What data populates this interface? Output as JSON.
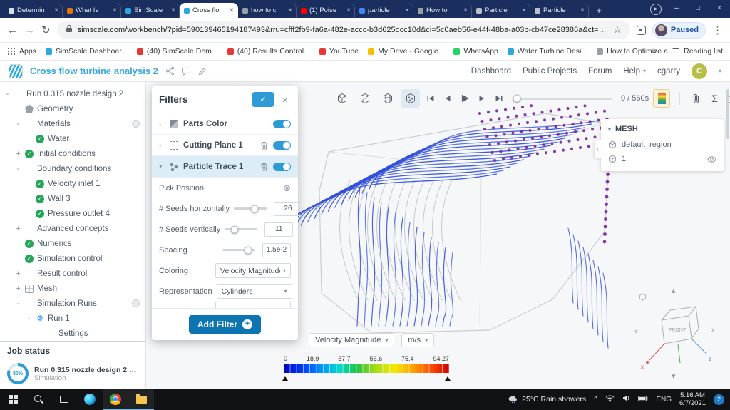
{
  "icons": {
    "back": "←",
    "forward": "→",
    "refresh": "↻",
    "star": "☆",
    "menu": "⋮",
    "close": "×",
    "check": "✓",
    "plus": "+",
    "play": "▶",
    "caret_down": "▾",
    "caret_up": "▴",
    "chev_left": "‹",
    "chev_right": "›",
    "overflow": "»",
    "sigma": "Σ",
    "gear": "⚙",
    "target": "⊗",
    "tray_up": "^"
  },
  "browser": {
    "window": {
      "minimize": "–",
      "maximize": "□",
      "close": "×"
    },
    "tabs": [
      {
        "label": "Determin",
        "color": "#d8dee6"
      },
      {
        "label": "What Is",
        "color": "#e8710a"
      },
      {
        "label": "SimScale",
        "color": "#29a8df"
      },
      {
        "label": "Cross flo",
        "color": "#29a8df",
        "active": true
      },
      {
        "label": "how to c",
        "color": "#9aa0a6"
      },
      {
        "label": "(1) Poise",
        "color": "#ff0000"
      },
      {
        "label": "particle",
        "color": "#4285f4"
      },
      {
        "label": "How to",
        "color": "#9aa0a6"
      },
      {
        "label": "Particle",
        "color": "#bdc1c6"
      },
      {
        "label": "Particle",
        "color": "#bdc1c6"
      }
    ],
    "url": "simscale.com/workbench/?pid=590139465194187493&rru=cfff2fb9-fa6a-482e-accc-b3d625dcc10d&ci=5c0aeb56-e44f-48ba-a03b-cb47ce28386a&ct=SOLUTION_...",
    "paused_label": "Paused",
    "apps_label": "Apps",
    "bookmarks": [
      {
        "label": "SimScale Dashboar...",
        "color": "#2da9dd"
      },
      {
        "label": "(40) SimScale Dem...",
        "color": "#e53935"
      },
      {
        "label": "(40) Results Control...",
        "color": "#e53935"
      },
      {
        "label": "YouTube",
        "color": "#e53935"
      },
      {
        "label": "My Drive - Google...",
        "color": "#fbbc04"
      },
      {
        "label": "WhatsApp",
        "color": "#25d366"
      },
      {
        "label": "Water Turbine Desi...",
        "color": "#2da9dd"
      },
      {
        "label": "How to Optimize a...",
        "color": "#9aa0a6"
      }
    ],
    "reading_list_label": "Reading list"
  },
  "app_header": {
    "project_title": "Cross flow turbine analysis 2",
    "nav": [
      "Dashboard",
      "Public Projects",
      "Forum",
      "Help"
    ],
    "user": "cgarry",
    "avatar": "C"
  },
  "tree": {
    "items": [
      {
        "label": "Run 0.315 nozzle design 2",
        "level": 0,
        "exp": "-",
        "status": "none"
      },
      {
        "label": "Geometry",
        "level": 1,
        "exp": "",
        "status": "geometry"
      },
      {
        "label": "Materials",
        "level": 1,
        "exp": "-",
        "status": "none",
        "menu": true
      },
      {
        "label": "Water",
        "level": 2,
        "exp": "",
        "status": "check"
      },
      {
        "label": "Initial conditions",
        "level": 1,
        "exp": "+",
        "status": "check"
      },
      {
        "label": "Boundary conditions",
        "level": 1,
        "exp": "-",
        "status": "none"
      },
      {
        "label": "Velocity inlet 1",
        "level": 2,
        "exp": "",
        "status": "check"
      },
      {
        "label": "Wall 3",
        "level": 2,
        "exp": "",
        "status": "check"
      },
      {
        "label": "Pressure outlet 4",
        "level": 2,
        "exp": "",
        "status": "check"
      },
      {
        "label": "Advanced concepts",
        "level": 1,
        "exp": "+",
        "status": "none"
      },
      {
        "label": "Numerics",
        "level": 1,
        "exp": "",
        "status": "check"
      },
      {
        "label": "Simulation control",
        "level": 1,
        "exp": "",
        "status": "check"
      },
      {
        "label": "Result control",
        "level": 1,
        "exp": "+",
        "status": "none"
      },
      {
        "label": "Mesh",
        "level": 1,
        "exp": "+",
        "status": "mesh"
      },
      {
        "label": "Simulation Runs",
        "level": 1,
        "exp": "-",
        "status": "none",
        "menu": true
      },
      {
        "label": "Run 1",
        "level": 2,
        "exp": "-",
        "status": "gear"
      },
      {
        "label": "Settings",
        "level": 3,
        "exp": "",
        "status": "none"
      }
    ]
  },
  "job_status": {
    "title": "Job status",
    "progress_label": "80%",
    "run_label": "Run 0.315 nozzle design 2 - ...",
    "run_sub": "Simulation"
  },
  "filters": {
    "title": "Filters",
    "rows": [
      {
        "label": "Parts Color",
        "icon": "parts",
        "trash": false,
        "expanded": false
      },
      {
        "label": "Cutting Plane 1",
        "icon": "plane",
        "trash": true,
        "expanded": false
      },
      {
        "label": "Particle Trace 1",
        "icon": "trace",
        "trash": true,
        "expanded": true,
        "selected": true
      }
    ],
    "controls": {
      "pick_position_label": "Pick Position",
      "seeds_h_label": "# Seeds horizontally",
      "seeds_h_value": "26",
      "seeds_v_label": "# Seeds vertically",
      "seeds_v_value": "11",
      "spacing_label": "Spacing",
      "spacing_value": "1.5e-2",
      "coloring_label": "Coloring",
      "coloring_value": "Velocity Magnitude",
      "representation_label": "Representation",
      "representation_value": "Cylinders"
    },
    "add_filter_label": "Add Filter"
  },
  "viewport": {
    "time_display": "0 / 560s",
    "mesh_panel": {
      "title": "MESH",
      "items": [
        {
          "label": "default_region"
        },
        {
          "label": "1"
        }
      ]
    },
    "legend": {
      "field": "Velocity Magnitude",
      "unit": "m/s",
      "ticks": [
        "0",
        "18.9",
        "37.7",
        "56.6",
        "75.4",
        "94.27"
      ]
    },
    "nav_cube": {
      "front": "FRONT",
      "x": "x",
      "z": "z"
    }
  },
  "scene": {
    "stream": "#2440cf",
    "stream2": "#3f5fe3",
    "seeds": "#7b1fa2",
    "geom": "#c4c9cf",
    "blade": "#b8bdc3"
  },
  "taskbar": {
    "weather": "25°C Rain showers",
    "lang": "ENG",
    "time": "5:16 AM",
    "date": "6/7/2021",
    "badge": "2"
  }
}
